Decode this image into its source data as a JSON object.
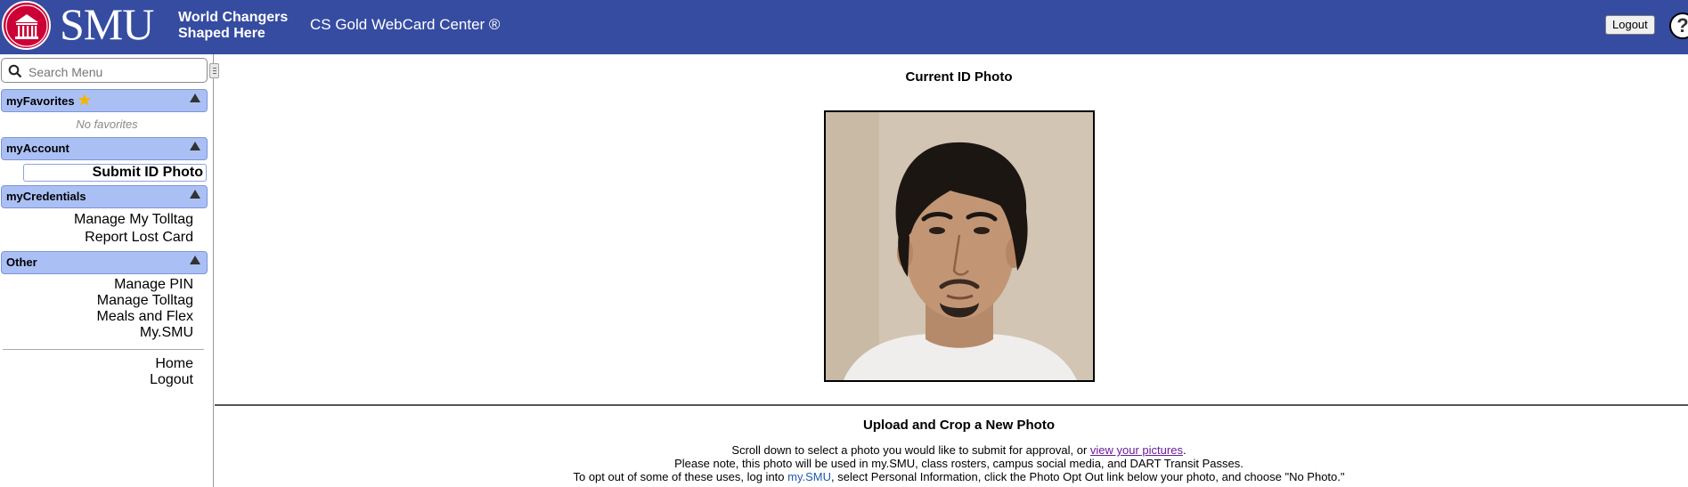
{
  "header": {
    "brand": "SMU",
    "tagline_line1": "World Changers",
    "tagline_line2": "Shaped Here",
    "app_title": "CS Gold WebCard Center ®",
    "logout_label": "Logout",
    "help_label": "?"
  },
  "sidebar": {
    "search_placeholder": "Search Menu",
    "favorites": {
      "title": "myFavorites",
      "empty_text": "No favorites"
    },
    "account": {
      "title": "myAccount",
      "items": [
        "Submit ID Photo"
      ]
    },
    "credentials": {
      "title": "myCredentials",
      "items": [
        "Manage My Tolltag",
        "Report Lost Card"
      ]
    },
    "other": {
      "title": "Other",
      "items": [
        "Manage PIN",
        "Manage Tolltag",
        "Meals and Flex",
        "My.SMU"
      ]
    },
    "footer_links": [
      "Home",
      "Logout"
    ]
  },
  "main": {
    "current_photo_title": "Current ID Photo",
    "upload_title": "Upload and Crop a New Photo",
    "line1_text": "Scroll down to select a photo you would like to submit for approval, or ",
    "line1_link": "view your pictures",
    "line1_end": ".",
    "line2": "Please note, this photo will be used in my.SMU, class rosters, campus social media, and DART Transit Passes.",
    "line3_start": "To opt out of some of these uses, log into ",
    "line3_link": "my.SMU",
    "line3_end": ", select Personal Information, click the Photo Opt Out link below your photo, and choose \"No Photo.\""
  },
  "colors": {
    "header_bg": "#354ca1",
    "section_header_bg": "#aac0f5",
    "brand_red": "#cc0035"
  }
}
